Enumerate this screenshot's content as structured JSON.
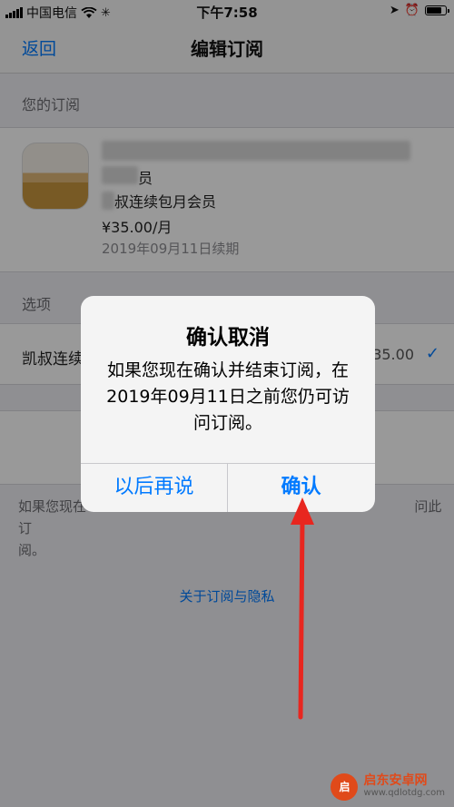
{
  "status_bar": {
    "carrier": "中国电信",
    "time": "下午7:58",
    "battery_level": 0.85
  },
  "nav": {
    "back_label": "返回",
    "title": "编辑订阅"
  },
  "subscription_section": {
    "header": "您的订阅",
    "plan_line1_visible": "员",
    "plan_line2_visible": "叔连续包月会员",
    "price": "¥35.00/月",
    "renew_date": "2019年09月11日续期"
  },
  "options_section": {
    "header": "选项",
    "option_label_visible": "凯叔连续",
    "option_price_visible": "35.00",
    "selected": true
  },
  "footnote": {
    "visible_start": "如果您现在",
    "visible_mid": "问此订",
    "visible_end": "阅。"
  },
  "privacy_link": "关于订阅与隐私",
  "alert": {
    "title": "确认取消",
    "message": "如果您现在确认并结束订阅，在2019年09月11日之前您仍可访问订阅。",
    "later_button": "以后再说",
    "confirm_button": "确认"
  },
  "annotation": {
    "color": "#e8261f"
  },
  "watermark": {
    "site": "启东安卓网",
    "url": "www.qdlotdg.com"
  },
  "colors": {
    "accent": "#007aff",
    "overlay": "rgba(0,0,0,0.40)"
  }
}
